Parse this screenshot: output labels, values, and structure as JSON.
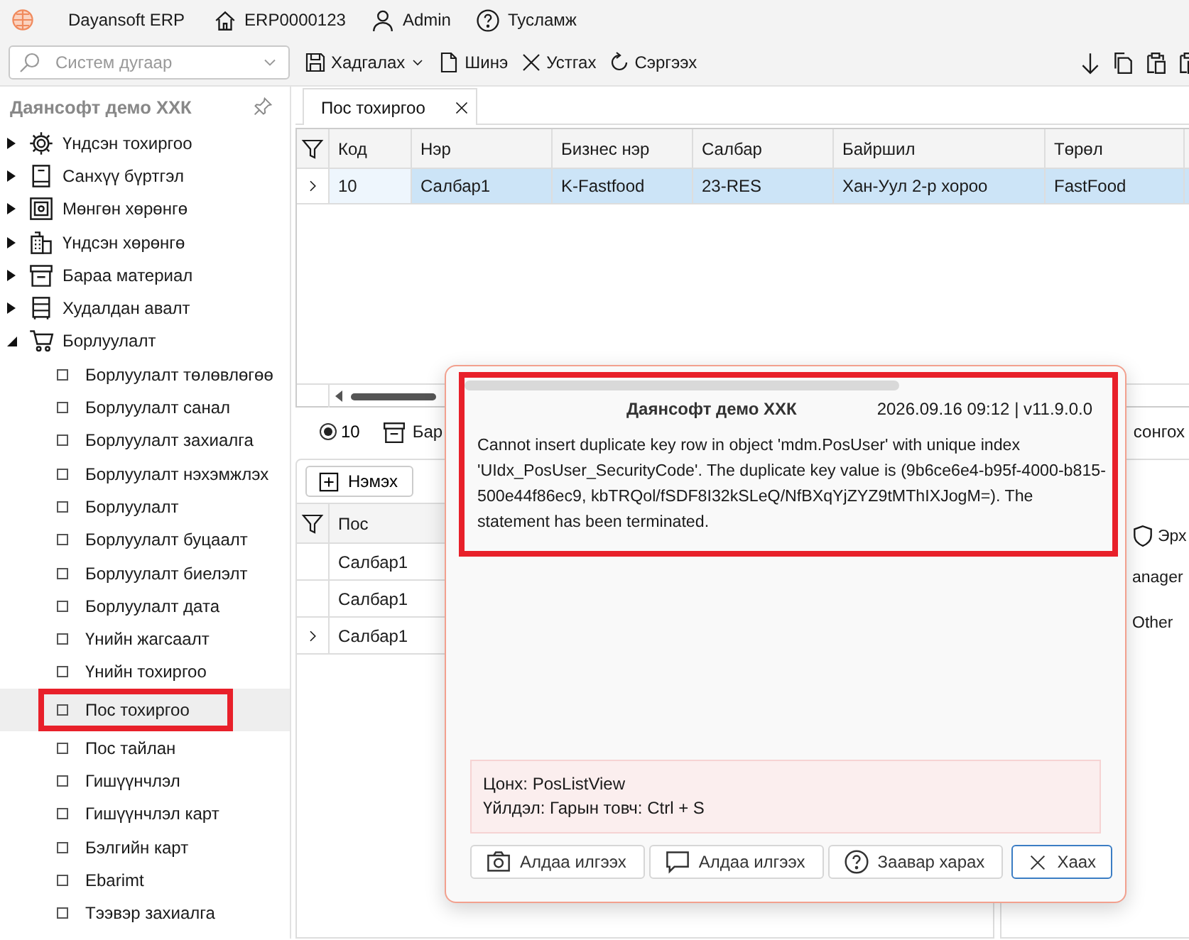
{
  "app_bar": {
    "title": "Dayansoft ERP",
    "document": "ERP0000123",
    "user": "Admin",
    "help": "Тусламж"
  },
  "toolbar": {
    "search": {
      "placeholder": "Систем дугаар"
    },
    "buttons": [
      {
        "kind": "save",
        "label": "Хадгалах",
        "has_menu": true
      },
      {
        "kind": "new",
        "label": "Шинэ",
        "has_menu": false
      },
      {
        "kind": "delete",
        "label": "Устгах",
        "has_menu": false
      },
      {
        "kind": "refresh",
        "label": "Сэргээх",
        "has_menu": false
      }
    ]
  },
  "sidebar": {
    "title": "Даянсофт демо ХХК",
    "items": [
      {
        "label": "Үндсэн тохиргоо",
        "expanded": false
      },
      {
        "label": "Санхүү бүртгэл",
        "expanded": false
      },
      {
        "label": "Мөнгөн хөрөнгө",
        "expanded": false
      },
      {
        "label": "Үндсэн хөрөнгө",
        "expanded": false
      },
      {
        "label": "Бараа материал",
        "expanded": false
      },
      {
        "label": "Худалдан авалт",
        "expanded": false
      },
      {
        "label": "Борлуулалт",
        "expanded": true,
        "children": [
          {
            "label": "Борлуулалт төлөвлөгөө",
            "selected": false,
            "highlighted": false
          },
          {
            "label": "Борлуулалт санал",
            "selected": false,
            "highlighted": false
          },
          {
            "label": "Борлуулалт захиалга",
            "selected": false,
            "highlighted": false
          },
          {
            "label": "Борлуулалт нэхэмжлэх",
            "selected": false,
            "highlighted": false
          },
          {
            "label": "Борлуулалт",
            "selected": false,
            "highlighted": false
          },
          {
            "label": "Борлуулалт буцаалт",
            "selected": false,
            "highlighted": false
          },
          {
            "label": "Борлуулалт биелэлт",
            "selected": false,
            "highlighted": false
          },
          {
            "label": "Борлуулалт дата",
            "selected": false,
            "highlighted": false
          },
          {
            "label": "Үнийн жагсаалт",
            "selected": false,
            "highlighted": false
          },
          {
            "label": "Үнийн тохиргоо",
            "selected": false,
            "highlighted": false
          },
          {
            "label": "Пос тохиргоо",
            "selected": true,
            "highlighted": true
          },
          {
            "label": "Пос тайлан",
            "selected": false,
            "highlighted": false
          },
          {
            "label": "Гишүүнчлэл",
            "selected": false,
            "highlighted": false
          },
          {
            "label": "Гишүүнчлэл карт",
            "selected": false,
            "highlighted": false
          },
          {
            "label": "Бэлгийн карт",
            "selected": false,
            "highlighted": false
          },
          {
            "label": "Ebarimt",
            "selected": false,
            "highlighted": false
          },
          {
            "label": "Тээвэр захиалга",
            "selected": false,
            "highlighted": false
          }
        ]
      }
    ]
  },
  "tabs": [
    {
      "label": "Пос тохиргоо",
      "selected": true
    }
  ],
  "pos_table": {
    "columns": [
      "Код",
      "Нэр",
      "Бизнес нэр",
      "Салбар",
      "Байршил",
      "Төрөл"
    ],
    "rows": [
      {
        "selected": true,
        "cells": [
          "10",
          "Салбар1",
          "K-Fastfood",
          "23-RES",
          "Хан-Уул 2-р хороо",
          "FastFood"
        ]
      }
    ]
  },
  "detail_toolbar": {
    "page_size": {
      "label": "10",
      "selected": true
    },
    "button_partial": "Бар",
    "right_partial": "сонгох"
  },
  "users_panel": {
    "add_button": "Нэмэх",
    "column": "Пос",
    "rows": [
      {
        "value": "Салбар1",
        "current": false
      },
      {
        "value": "Салбар1",
        "current": false
      },
      {
        "value": "Салбар1",
        "current": true
      }
    ]
  },
  "rights_panel": {
    "column": "Эрх",
    "rows": [
      "anager",
      "Other"
    ]
  },
  "error_dialog": {
    "company": "Даянсофт демо ХХК",
    "timestamp": "2026.09.16 09:12 | v11.9.0.0",
    "highlighted": true,
    "message": "Cannot insert duplicate key row in object 'mdm.PosUser' with unique index 'UIdx_PosUser_SecurityCode'. The duplicate key value is (9b6ce6e4-b95f-4000-b815-500e44f86ec9, kbTRQol/fSDF8I32kSLeQ/NfBXqYjZYZ9tMThIXJogM=). The statement has been terminated.",
    "context": [
      "Цонх: PosListView",
      "Үйлдэл: Гарын товч: Ctrl + S"
    ],
    "buttons": [
      {
        "kind": "screenshot",
        "label": "Алдаа илгээх"
      },
      {
        "kind": "message",
        "label": "Алдаа илгээх"
      },
      {
        "kind": "help",
        "label": "Заавар харах"
      }
    ],
    "close_button": "Хаах"
  }
}
